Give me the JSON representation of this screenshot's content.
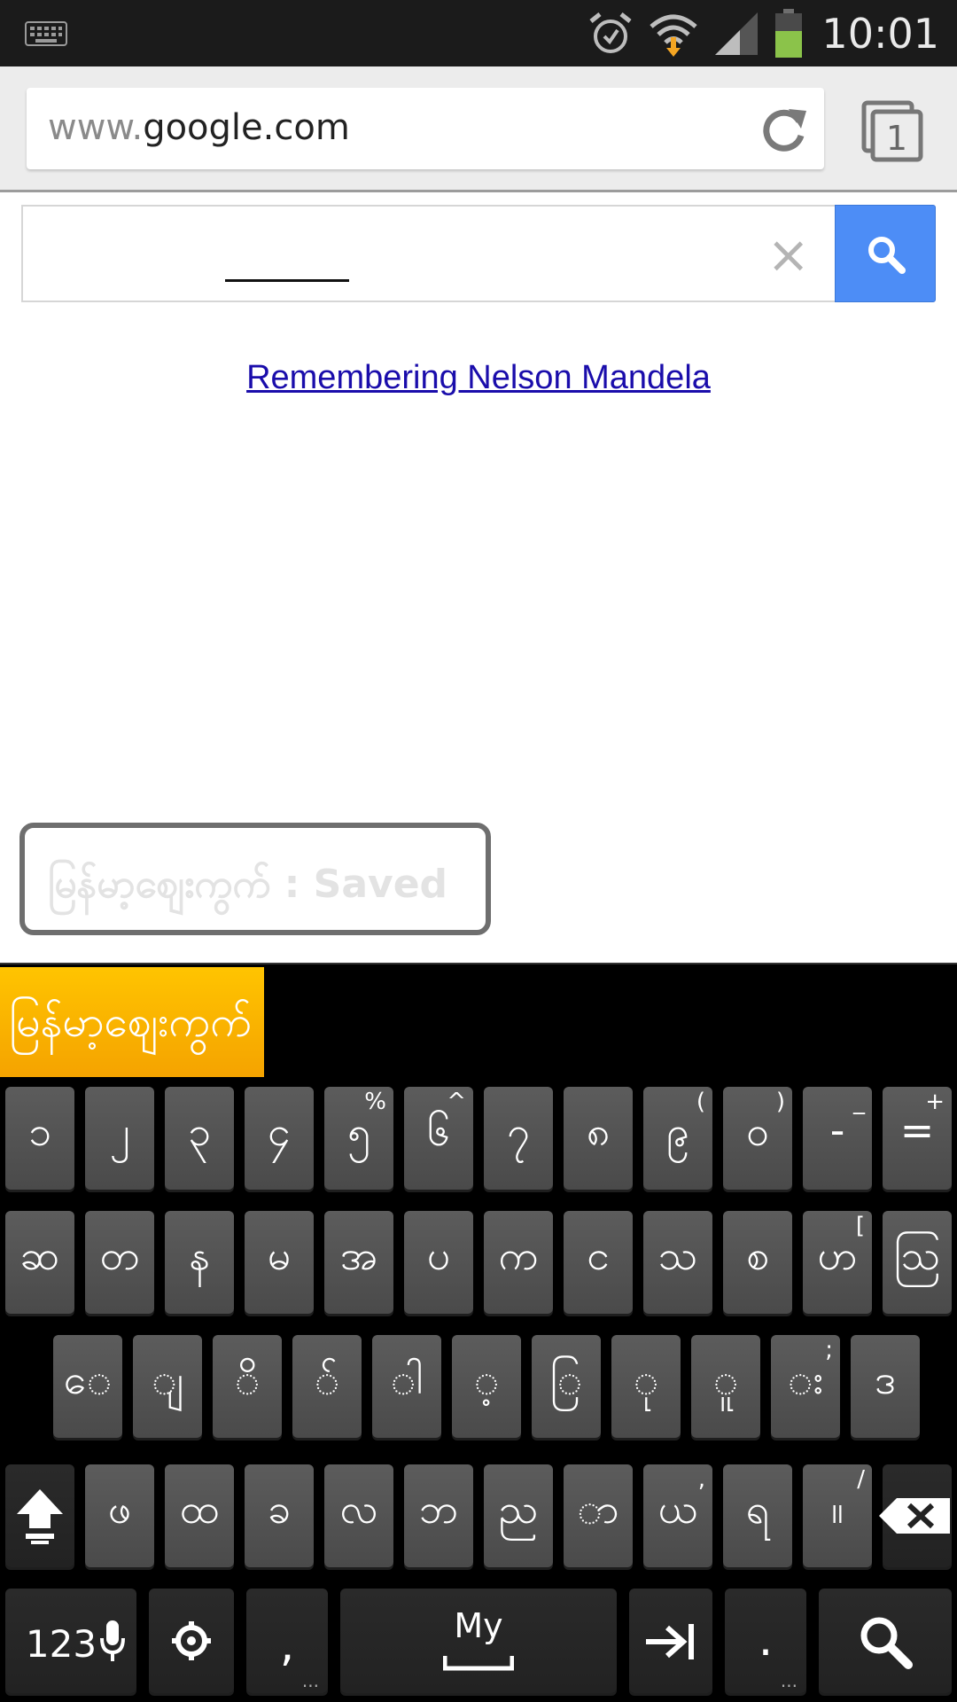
{
  "status_bar": {
    "time": "10:01",
    "icons": [
      "keyboard-icon",
      "alarm-icon",
      "wifi-icon",
      "signal-icon",
      "battery-icon"
    ]
  },
  "browser": {
    "url_prefix": "www.",
    "url_domain": "google.com",
    "tab_count": "1"
  },
  "page": {
    "search_value": "",
    "clear_symbol": "×",
    "doodle_link": "Remembering Nelson Mandela"
  },
  "toast": {
    "text": "မြန်မာ့စျေးကွက် : Saved"
  },
  "keyboard": {
    "language_chip": "မြန်မာ့စျေးကွက်",
    "rows": [
      [
        {
          "label": "၁",
          "hint": ""
        },
        {
          "label": "၂",
          "hint": ""
        },
        {
          "label": "၃",
          "hint": ""
        },
        {
          "label": "၄",
          "hint": ""
        },
        {
          "label": "၅",
          "hint": "%"
        },
        {
          "label": "၆",
          "hint": "^"
        },
        {
          "label": "၇",
          "hint": ""
        },
        {
          "label": "၈",
          "hint": ""
        },
        {
          "label": "၉",
          "hint": "("
        },
        {
          "label": "၀",
          "hint": ")"
        },
        {
          "label": "-",
          "hint": "_"
        },
        {
          "label": "=",
          "hint": "+"
        }
      ],
      [
        {
          "label": "ဆ",
          "hint": ""
        },
        {
          "label": "တ",
          "hint": ""
        },
        {
          "label": "န",
          "hint": ""
        },
        {
          "label": "မ",
          "hint": ""
        },
        {
          "label": "အ",
          "hint": ""
        },
        {
          "label": "ပ",
          "hint": ""
        },
        {
          "label": "က",
          "hint": ""
        },
        {
          "label": "င",
          "hint": ""
        },
        {
          "label": "သ",
          "hint": ""
        },
        {
          "label": "စ",
          "hint": ""
        },
        {
          "label": "ဟ",
          "hint": "["
        },
        {
          "label": "ဩ",
          "hint": ""
        }
      ],
      [
        {
          "label": "ေ",
          "hint": ""
        },
        {
          "label": "ျ",
          "hint": ""
        },
        {
          "label": "ိ",
          "hint": ""
        },
        {
          "label": "်",
          "hint": ""
        },
        {
          "label": "ါ",
          "hint": ""
        },
        {
          "label": "့",
          "hint": ""
        },
        {
          "label": "ြ",
          "hint": ""
        },
        {
          "label": "ု",
          "hint": ""
        },
        {
          "label": "ူ",
          "hint": ""
        },
        {
          "label": "း",
          "hint": ";"
        },
        {
          "label": "ဒ",
          "hint": ""
        }
      ],
      [
        {
          "label": "ဖ",
          "hint": ""
        },
        {
          "label": "ထ",
          "hint": ""
        },
        {
          "label": "ခ",
          "hint": ""
        },
        {
          "label": "လ",
          "hint": ""
        },
        {
          "label": "ဘ",
          "hint": ""
        },
        {
          "label": "ည",
          "hint": ""
        },
        {
          "label": "ာ",
          "hint": ""
        },
        {
          "label": "ယ",
          "hint": ","
        },
        {
          "label": "ရ",
          "hint": ""
        },
        {
          "label": "။",
          "hint": "/"
        }
      ]
    ],
    "bottom": {
      "numbers": "123",
      "comma": ",",
      "space_label": "My",
      "period": ".",
      "more_dots": "..."
    }
  }
}
